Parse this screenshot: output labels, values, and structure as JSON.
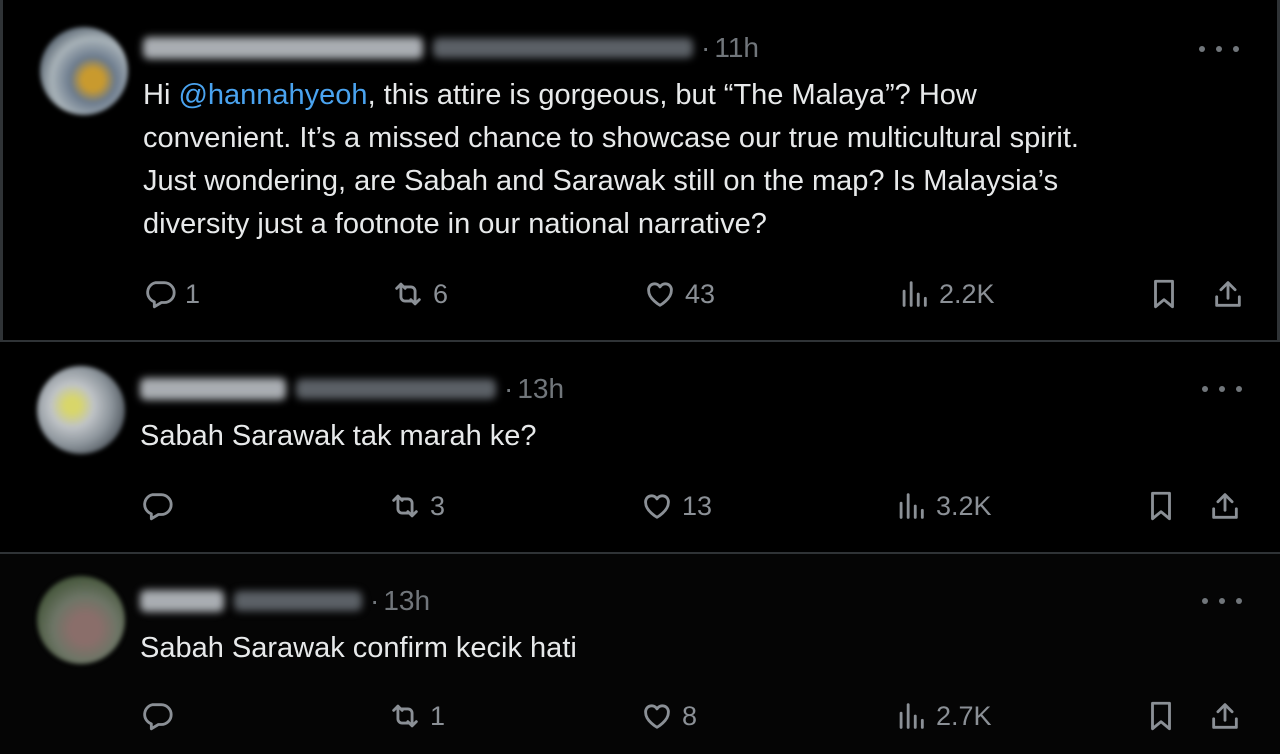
{
  "tweets": [
    {
      "time": "11h",
      "text_before": "Hi ",
      "mention": "@hannahyeoh",
      "text_after": ", this attire is gorgeous, but “The Malaya”? How\nconvenient. It’s a missed chance to showcase our true multicultural spirit.\nJust wondering, are Sabah and Sarawak still on the map? Is Malaysia’s\ndiversity just a footnote in our national narrative?",
      "replies": "1",
      "retweets": "6",
      "likes": "43",
      "views": "2.2K"
    },
    {
      "time": "13h",
      "text": "Sabah Sarawak tak marah ke?",
      "replies": "",
      "retweets": "3",
      "likes": "13",
      "views": "3.2K"
    },
    {
      "time": "13h",
      "text": "Sabah Sarawak confirm kecik hati",
      "replies": "",
      "retweets": "1",
      "likes": "8",
      "views": "2.7K"
    }
  ],
  "colors": {
    "background": "#000000",
    "text": "#e7e9ea",
    "secondary": "#71767b",
    "mention": "#4aa3ef",
    "divider": "#2f3336"
  },
  "icons": [
    "reply-icon",
    "retweet-icon",
    "like-icon",
    "views-icon",
    "bookmark-icon",
    "share-icon",
    "more-icon"
  ]
}
